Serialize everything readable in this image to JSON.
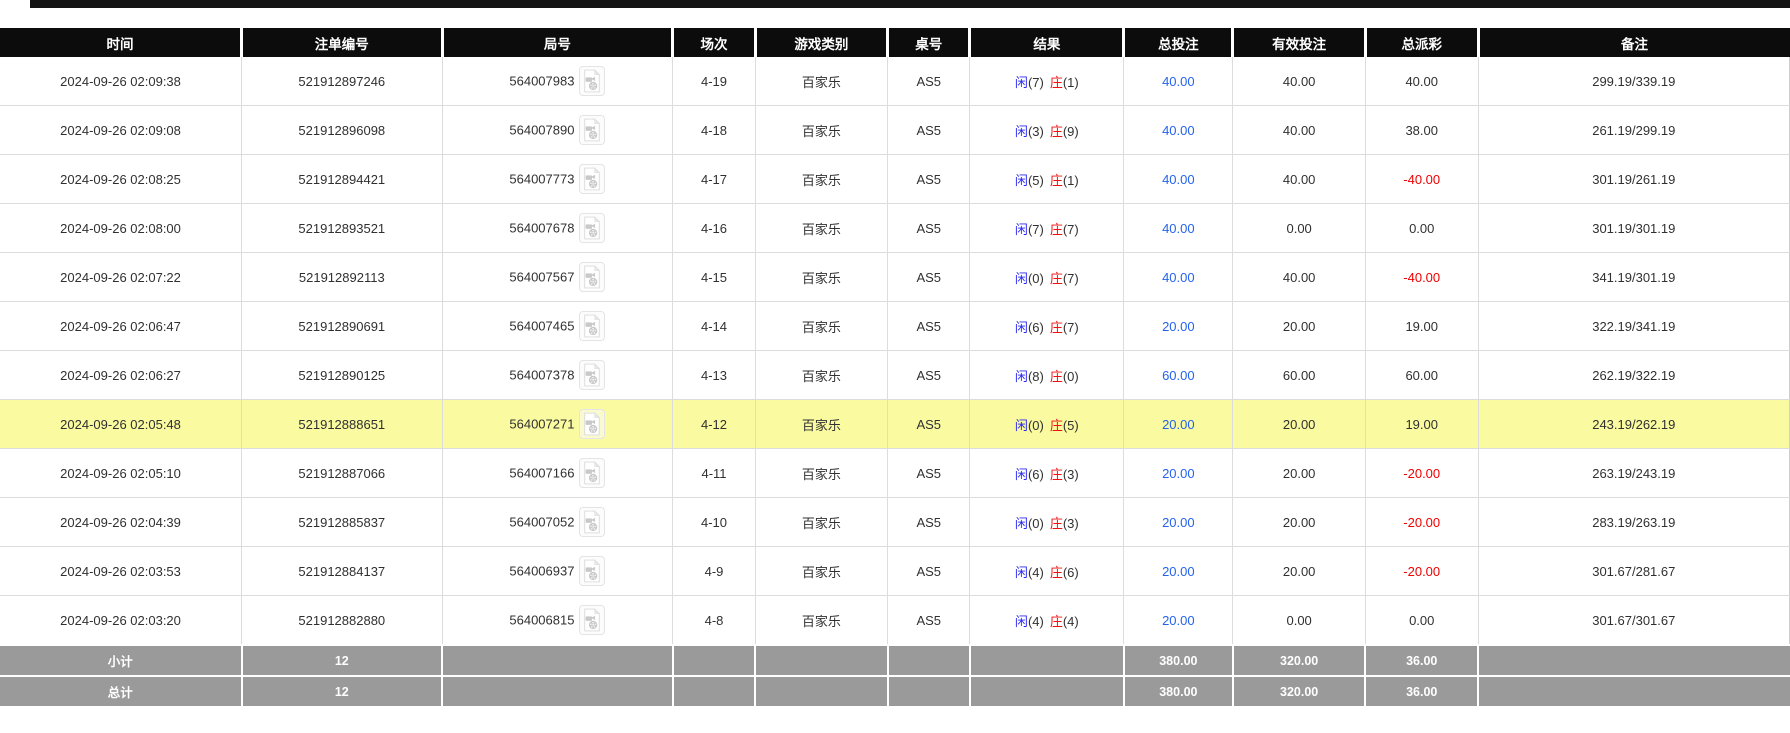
{
  "colors": {
    "header_bg": "#0c0c0c",
    "header_text": "#ffffff",
    "highlight_row_bg": "#fafaa0",
    "summary_row_bg": "#9a9a9a",
    "summary_row_text": "#ffffff",
    "player_blue": "#2b2bee",
    "banker_red": "#ee1111",
    "bet_amount_blue": "#2563eb",
    "negative_red": "#f00000",
    "body_text": "#303030"
  },
  "icons": {
    "video_replay": "video-replay-icon"
  },
  "table": {
    "columns": [
      {
        "key": "time",
        "label": "时间"
      },
      {
        "key": "order_no",
        "label": "注单编号"
      },
      {
        "key": "round_no",
        "label": "局号"
      },
      {
        "key": "session",
        "label": "场次"
      },
      {
        "key": "game_type",
        "label": "游戏类别"
      },
      {
        "key": "table_no",
        "label": "桌号"
      },
      {
        "key": "result",
        "label": "结果"
      },
      {
        "key": "total_bet",
        "label": "总投注"
      },
      {
        "key": "valid_bet",
        "label": "有效投注"
      },
      {
        "key": "payout",
        "label": "总派彩"
      },
      {
        "key": "remark",
        "label": "备注"
      }
    ],
    "rows": [
      {
        "time": "2024-09-26 02:09:38",
        "order_no": "521912897246",
        "round_no": "564007983",
        "session": "4-19",
        "game_type": "百家乐",
        "table_no": "AS5",
        "result": {
          "player": "闲",
          "player_score": "(7)",
          "banker": "庄",
          "banker_score": "(1)"
        },
        "total_bet": "40.00",
        "valid_bet": "40.00",
        "payout": "40.00",
        "remark": "299.19/339.19",
        "highlighted": false
      },
      {
        "time": "2024-09-26 02:09:08",
        "order_no": "521912896098",
        "round_no": "564007890",
        "session": "4-18",
        "game_type": "百家乐",
        "table_no": "AS5",
        "result": {
          "player": "闲",
          "player_score": "(3)",
          "banker": "庄",
          "banker_score": "(9)"
        },
        "total_bet": "40.00",
        "valid_bet": "40.00",
        "payout": "38.00",
        "remark": "261.19/299.19",
        "highlighted": false
      },
      {
        "time": "2024-09-26 02:08:25",
        "order_no": "521912894421",
        "round_no": "564007773",
        "session": "4-17",
        "game_type": "百家乐",
        "table_no": "AS5",
        "result": {
          "player": "闲",
          "player_score": "(5)",
          "banker": "庄",
          "banker_score": "(1)"
        },
        "total_bet": "40.00",
        "valid_bet": "40.00",
        "payout": "-40.00",
        "remark": "301.19/261.19",
        "highlighted": false
      },
      {
        "time": "2024-09-26 02:08:00",
        "order_no": "521912893521",
        "round_no": "564007678",
        "session": "4-16",
        "game_type": "百家乐",
        "table_no": "AS5",
        "result": {
          "player": "闲",
          "player_score": "(7)",
          "banker": "庄",
          "banker_score": "(7)"
        },
        "total_bet": "40.00",
        "valid_bet": "0.00",
        "payout": "0.00",
        "remark": "301.19/301.19",
        "highlighted": false
      },
      {
        "time": "2024-09-26 02:07:22",
        "order_no": "521912892113",
        "round_no": "564007567",
        "session": "4-15",
        "game_type": "百家乐",
        "table_no": "AS5",
        "result": {
          "player": "闲",
          "player_score": "(0)",
          "banker": "庄",
          "banker_score": "(7)"
        },
        "total_bet": "40.00",
        "valid_bet": "40.00",
        "payout": "-40.00",
        "remark": "341.19/301.19",
        "highlighted": false
      },
      {
        "time": "2024-09-26 02:06:47",
        "order_no": "521912890691",
        "round_no": "564007465",
        "session": "4-14",
        "game_type": "百家乐",
        "table_no": "AS5",
        "result": {
          "player": "闲",
          "player_score": "(6)",
          "banker": "庄",
          "banker_score": "(7)"
        },
        "total_bet": "20.00",
        "valid_bet": "20.00",
        "payout": "19.00",
        "remark": "322.19/341.19",
        "highlighted": false
      },
      {
        "time": "2024-09-26 02:06:27",
        "order_no": "521912890125",
        "round_no": "564007378",
        "session": "4-13",
        "game_type": "百家乐",
        "table_no": "AS5",
        "result": {
          "player": "闲",
          "player_score": "(8)",
          "banker": "庄",
          "banker_score": "(0)"
        },
        "total_bet": "60.00",
        "valid_bet": "60.00",
        "payout": "60.00",
        "remark": "262.19/322.19",
        "highlighted": false
      },
      {
        "time": "2024-09-26 02:05:48",
        "order_no": "521912888651",
        "round_no": "564007271",
        "session": "4-12",
        "game_type": "百家乐",
        "table_no": "AS5",
        "result": {
          "player": "闲",
          "player_score": "(0)",
          "banker": "庄",
          "banker_score": "(5)"
        },
        "total_bet": "20.00",
        "valid_bet": "20.00",
        "payout": "19.00",
        "remark": "243.19/262.19",
        "highlighted": true
      },
      {
        "time": "2024-09-26 02:05:10",
        "order_no": "521912887066",
        "round_no": "564007166",
        "session": "4-11",
        "game_type": "百家乐",
        "table_no": "AS5",
        "result": {
          "player": "闲",
          "player_score": "(6)",
          "banker": "庄",
          "banker_score": "(3)"
        },
        "total_bet": "20.00",
        "valid_bet": "20.00",
        "payout": "-20.00",
        "remark": "263.19/243.19",
        "highlighted": false
      },
      {
        "time": "2024-09-26 02:04:39",
        "order_no": "521912885837",
        "round_no": "564007052",
        "session": "4-10",
        "game_type": "百家乐",
        "table_no": "AS5",
        "result": {
          "player": "闲",
          "player_score": "(0)",
          "banker": "庄",
          "banker_score": "(3)"
        },
        "total_bet": "20.00",
        "valid_bet": "20.00",
        "payout": "-20.00",
        "remark": "283.19/263.19",
        "highlighted": false
      },
      {
        "time": "2024-09-26 02:03:53",
        "order_no": "521912884137",
        "round_no": "564006937",
        "session": "4-9",
        "game_type": "百家乐",
        "table_no": "AS5",
        "result": {
          "player": "闲",
          "player_score": "(4)",
          "banker": "庄",
          "banker_score": "(6)"
        },
        "total_bet": "20.00",
        "valid_bet": "20.00",
        "payout": "-20.00",
        "remark": "301.67/281.67",
        "highlighted": false
      },
      {
        "time": "2024-09-26 02:03:20",
        "order_no": "521912882880",
        "round_no": "564006815",
        "session": "4-8",
        "game_type": "百家乐",
        "table_no": "AS5",
        "result": {
          "player": "闲",
          "player_score": "(4)",
          "banker": "庄",
          "banker_score": "(4)"
        },
        "total_bet": "20.00",
        "valid_bet": "0.00",
        "payout": "0.00",
        "remark": "301.67/301.67",
        "highlighted": false
      }
    ],
    "summary_rows": [
      {
        "label": "小计",
        "count": "12",
        "total_bet": "380.00",
        "valid_bet": "320.00",
        "payout": "36.00"
      },
      {
        "label": "总计",
        "count": "12",
        "total_bet": "380.00",
        "valid_bet": "320.00",
        "payout": "36.00"
      }
    ]
  }
}
